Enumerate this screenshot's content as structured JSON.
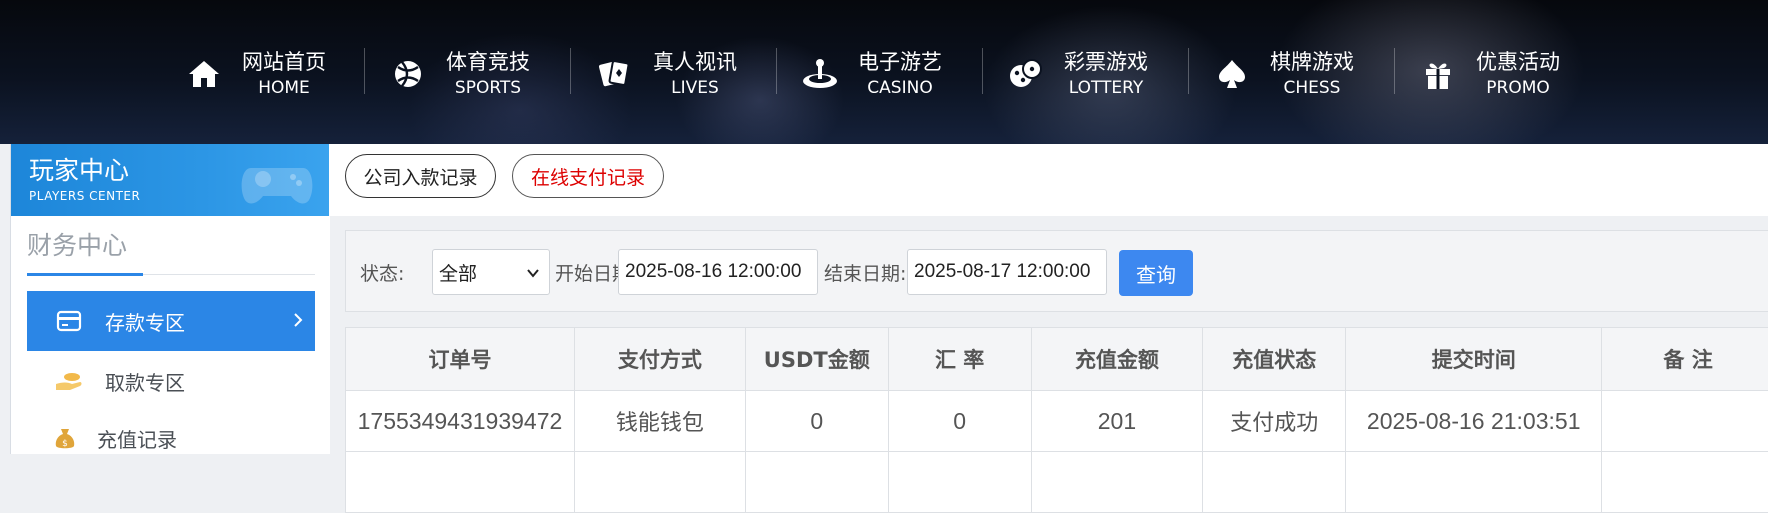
{
  "nav": {
    "items": [
      {
        "cn": "网站首页",
        "en": "HOME",
        "icon": "home-icon"
      },
      {
        "cn": "体育竞技",
        "en": "SPORTS",
        "icon": "ball-icon"
      },
      {
        "cn": "真人视讯",
        "en": "LIVES",
        "icon": "cards-icon"
      },
      {
        "cn": "电子游艺",
        "en": "CASINO",
        "icon": "slot-icon"
      },
      {
        "cn": "彩票游戏",
        "en": "LOTTERY",
        "icon": "dice-icon"
      },
      {
        "cn": "棋牌游戏",
        "en": "CHESS",
        "icon": "spade-icon"
      },
      {
        "cn": "优惠活动",
        "en": "PROMO",
        "icon": "gift-icon"
      }
    ]
  },
  "sidebar": {
    "header_cn": "玩家中心",
    "header_en": "PLAYERS CENTER",
    "section_title": "财务中心",
    "items": [
      {
        "label": "存款专区",
        "icon": "card-icon",
        "active": true
      },
      {
        "label": "取款专区",
        "icon": "hand-coin-icon",
        "active": false
      },
      {
        "label": "充值记录",
        "icon": "money-bag-icon",
        "active": false
      }
    ]
  },
  "tabs": [
    {
      "label": "公司入款记录",
      "active": false
    },
    {
      "label": "在线支付记录",
      "active": true
    }
  ],
  "filter": {
    "status_label": "状态:",
    "status_value": "全部",
    "start_label": "开始日期:",
    "start_value": "2025-08-16 12:00:00",
    "end_label": "结束日期:",
    "end_value": "2025-08-17 12:00:00",
    "query_label": "查询"
  },
  "table": {
    "headers": [
      "订单号",
      "支付方式",
      "USDT金额",
      "汇 率",
      "充值金额",
      "充值状态",
      "提交时间",
      "备 注"
    ],
    "rows": [
      [
        "1755349431939472",
        "钱能钱包",
        "0",
        "0",
        "201",
        "支付成功",
        "2025-08-16 21:03:51",
        ""
      ]
    ]
  },
  "colors": {
    "accent": "#2b86e6",
    "active_tab_text": "#dd0000",
    "query_button": "#3d88f0"
  }
}
